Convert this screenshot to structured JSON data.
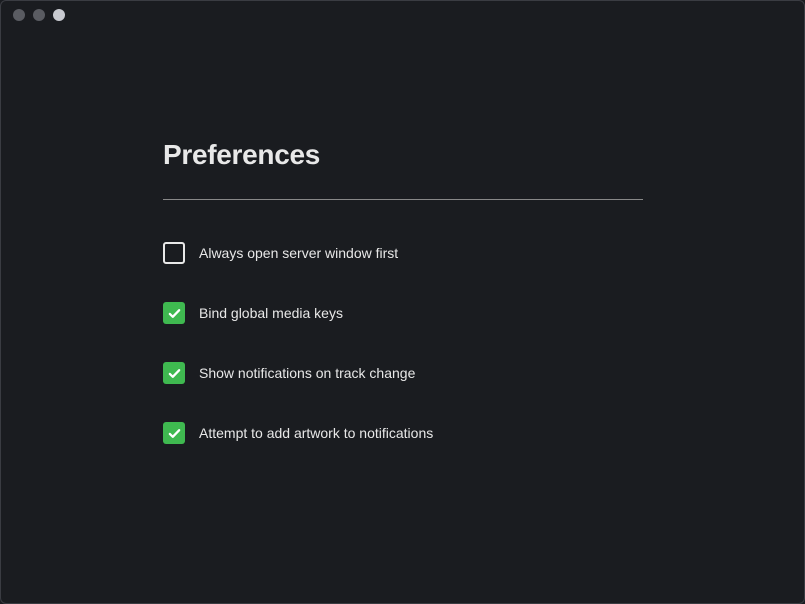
{
  "page": {
    "title": "Preferences"
  },
  "options": [
    {
      "label": "Always open server window first",
      "checked": false
    },
    {
      "label": "Bind global media keys",
      "checked": true
    },
    {
      "label": "Show notifications on track change",
      "checked": true
    },
    {
      "label": "Attempt to add artwork to notifications",
      "checked": true
    }
  ],
  "colors": {
    "background": "#1a1c20",
    "text": "#e8e8e8",
    "accent_green": "#3fb950"
  }
}
